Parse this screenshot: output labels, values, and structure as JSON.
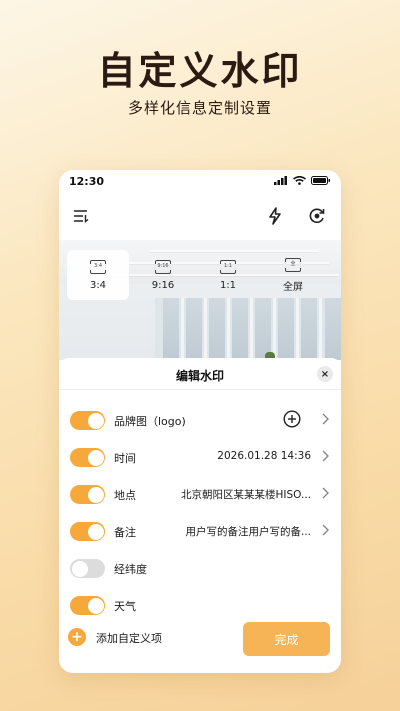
{
  "promo": {
    "title": "自定义水印",
    "subtitle": "多样化信息定制设置"
  },
  "status_bar": {
    "time": "12:30"
  },
  "toolbar": {
    "menu_icon": "menu-list-icon",
    "flash_icon": "flash-icon",
    "camera_flip_icon": "camera-switch-icon"
  },
  "aspect_ratios": [
    {
      "icon_text": "3:4",
      "label": "3:4",
      "selected": true
    },
    {
      "icon_text": "9:16",
      "label": "9:16",
      "selected": false
    },
    {
      "icon_text": "1:1",
      "label": "1:1",
      "selected": false
    },
    {
      "icon_text": "全",
      "label": "全屏",
      "selected": false
    }
  ],
  "sheet": {
    "title": "编辑水印",
    "rows": [
      {
        "label": "品牌图（logo)",
        "value": "",
        "enabled": true
      },
      {
        "label": "时间",
        "value": "2026.01.28 14:36",
        "enabled": true
      },
      {
        "label": "地点",
        "value": "北京朝阳区某某某楼HISO...",
        "enabled": true
      },
      {
        "label": "备注",
        "value": "用户写的备注用户写的备...",
        "enabled": true
      },
      {
        "label": "经纬度",
        "value": "",
        "enabled": false
      },
      {
        "label": "天气",
        "value": "",
        "enabled": true
      }
    ],
    "add_custom_label": "添加自定义项",
    "add_custom_icon": "+",
    "done_label": "完成",
    "close_icon": "×"
  },
  "colors": {
    "accent": "#f6a93a",
    "done_button": "#f7b456",
    "toggle_off": "#dcdcdc",
    "title_brown": "#2a1a12"
  }
}
